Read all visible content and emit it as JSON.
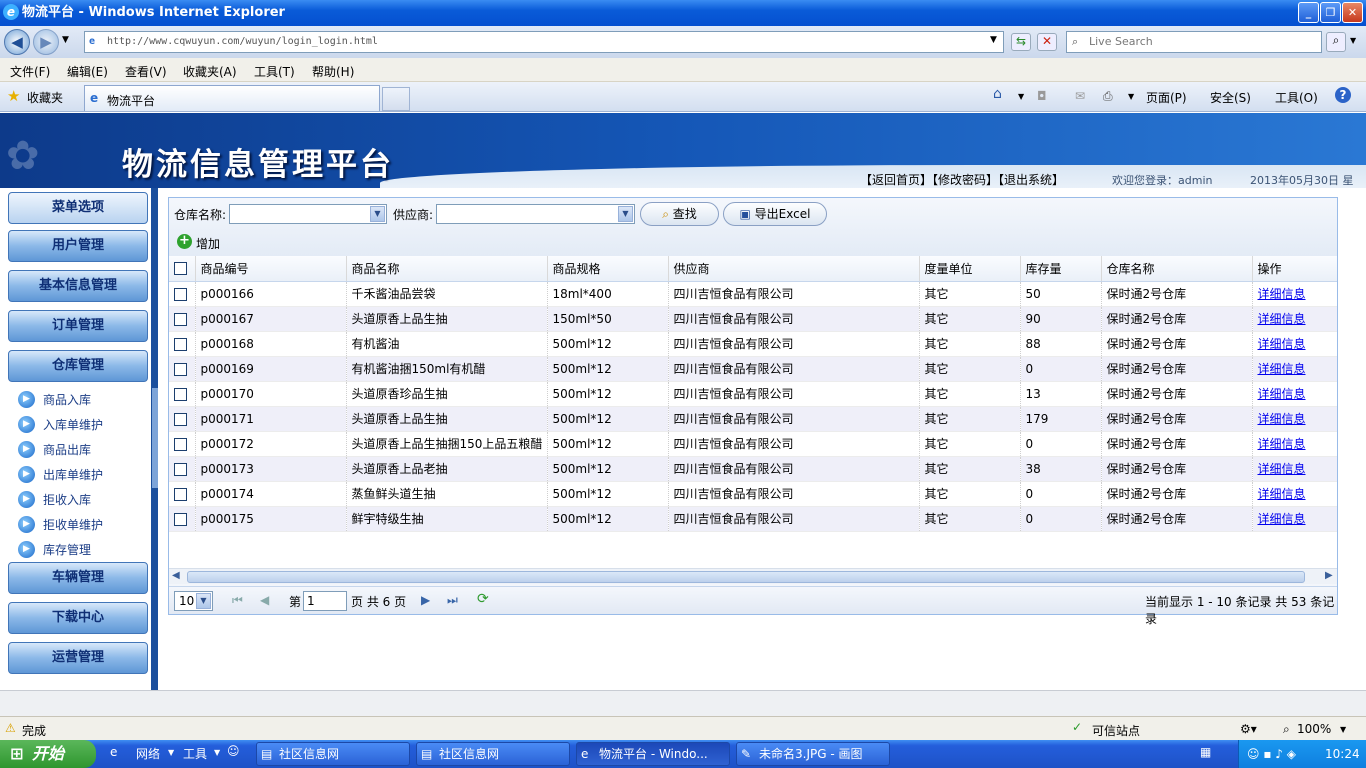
{
  "window": {
    "title": "物流平台 - Windows Internet Explorer"
  },
  "addressbar": {
    "url": "http://www.cqwuyun.com/wuyun/login_login.html",
    "search_placeholder": "Live Search"
  },
  "menubar": [
    "文件(F)",
    "编辑(E)",
    "查看(V)",
    "收藏夹(A)",
    "工具(T)",
    "帮助(H)"
  ],
  "favbar": {
    "favorites_label": "收藏夹",
    "tab_title": "物流平台",
    "page_menu": "页面(P)",
    "safety_menu": "安全(S)",
    "tools_menu": "工具(O)"
  },
  "banner": {
    "title": "物流信息管理平台",
    "links": "【返回首页】【修改密码】【退出系统】",
    "welcome": "欢迎您登录：admin",
    "date": "2013年05月30日 星"
  },
  "sidebar": {
    "header": "菜单选项",
    "groups": [
      "用户管理",
      "基本信息管理",
      "订单管理",
      "仓库管理"
    ],
    "sub_items": [
      "商品入库",
      "入库单维护",
      "商品出库",
      "出库单维护",
      "拒收入库",
      "拒收单维护",
      "库存管理"
    ],
    "bottom_groups": [
      "车辆管理",
      "下载中心",
      "运营管理"
    ]
  },
  "filters": {
    "warehouse_label": "仓库名称:",
    "supplier_label": "供应商:",
    "search_button": "查找",
    "export_button": "导出Excel",
    "add_button": "增加"
  },
  "table": {
    "headers": [
      "商品编号",
      "商品名称",
      "商品规格",
      "供应商",
      "度量单位",
      "库存量",
      "仓库名称",
      "操作"
    ],
    "rows": [
      [
        "p000166",
        "千禾酱油品尝袋",
        "18ml*400",
        "四川吉恒食品有限公司",
        "其它",
        "50",
        "保时通2号仓库",
        "详细信息"
      ],
      [
        "p000167",
        "头道原香上品生抽",
        "150ml*50",
        "四川吉恒食品有限公司",
        "其它",
        "90",
        "保时通2号仓库",
        "详细信息"
      ],
      [
        "p000168",
        "有机酱油",
        "500ml*12",
        "四川吉恒食品有限公司",
        "其它",
        "88",
        "保时通2号仓库",
        "详细信息"
      ],
      [
        "p000169",
        "有机酱油捆150ml有机醋",
        "500ml*12",
        "四川吉恒食品有限公司",
        "其它",
        "0",
        "保时通2号仓库",
        "详细信息"
      ],
      [
        "p000170",
        "头道原香珍品生抽",
        "500ml*12",
        "四川吉恒食品有限公司",
        "其它",
        "13",
        "保时通2号仓库",
        "详细信息"
      ],
      [
        "p000171",
        "头道原香上品生抽",
        "500ml*12",
        "四川吉恒食品有限公司",
        "其它",
        "179",
        "保时通2号仓库",
        "详细信息"
      ],
      [
        "p000172",
        "头道原香上品生抽捆150上品五粮醋",
        "500ml*12",
        "四川吉恒食品有限公司",
        "其它",
        "0",
        "保时通2号仓库",
        "详细信息"
      ],
      [
        "p000173",
        "头道原香上品老抽",
        "500ml*12",
        "四川吉恒食品有限公司",
        "其它",
        "38",
        "保时通2号仓库",
        "详细信息"
      ],
      [
        "p000174",
        "蒸鱼鲜头道生抽",
        "500ml*12",
        "四川吉恒食品有限公司",
        "其它",
        "0",
        "保时通2号仓库",
        "详细信息"
      ],
      [
        "p000175",
        "鲜宇特级生抽",
        "500ml*12",
        "四川吉恒食品有限公司",
        "其它",
        "0",
        "保时通2号仓库",
        "详细信息"
      ]
    ]
  },
  "pager": {
    "page_size": "10",
    "page_prefix": "第",
    "page_value": "1",
    "page_suffix": "页 共 6 页",
    "summary": "当前显示 1 - 10 条记录 共 53 条记录"
  },
  "statusbar": {
    "status": "完成",
    "zone": "可信站点",
    "zoom": "100%"
  },
  "taskbar": {
    "start": "开始",
    "quick": [
      "网络",
      "工具"
    ],
    "items": [
      "社区信息网",
      "社区信息网",
      "物流平台 - Windo...",
      "未命名3.JPG - 画图"
    ],
    "clock": "10:24"
  }
}
